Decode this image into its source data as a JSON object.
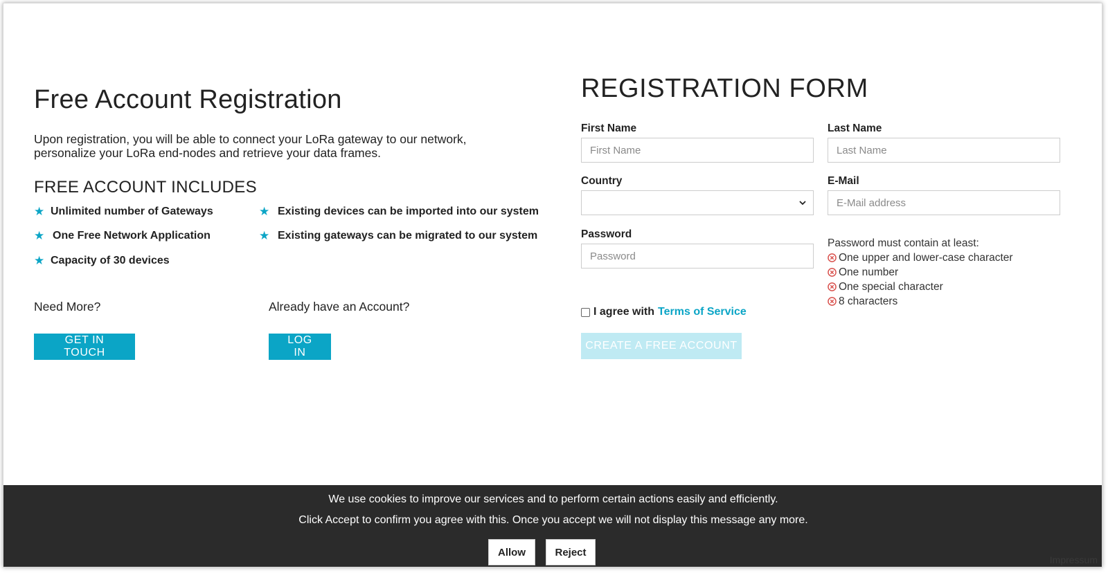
{
  "left": {
    "title": "Free Account Registration",
    "intro": "Upon registration, you will be able to connect your LoRa gateway to our network, personalize your LoRa end-nodes and retrieve your data frames.",
    "includes_title": "FREE ACCOUNT INCLUDES",
    "features": [
      "Unlimited number of Gateways",
      "One Free Network Application",
      "Capacity of 30 devices",
      "Existing devices can be imported into our system",
      "Existing gateways can be migrated to our system"
    ],
    "need_more": "Need More?",
    "get_in_touch": "GET IN TOUCH",
    "have_account": "Already have an Account?",
    "log_in": "LOG IN"
  },
  "form": {
    "title": "REGISTRATION FORM",
    "first_name_label": "First Name",
    "first_name_placeholder": "First Name",
    "last_name_label": "Last Name",
    "last_name_placeholder": "Last Name",
    "country_label": "Country",
    "country_value": "",
    "email_label": "E-Mail",
    "email_placeholder": "E-Mail address",
    "password_label": "Password",
    "password_placeholder": "Password",
    "password_rules_title": "Password must contain at least:",
    "password_rules": [
      "One upper and lower-case character",
      "One number",
      "One special character",
      "8 characters"
    ],
    "agree_text": "I agree with",
    "tos_link": "Terms of Service",
    "submit": "CREATE A FREE ACCOUNT"
  },
  "cookie": {
    "line1": "We use cookies to improve our services and to perform certain actions easily and efficiently.",
    "line2": "Click Accept to confirm you agree with this. Once you accept we will not display this message any more.",
    "allow": "Allow",
    "reject": "Reject"
  },
  "footer": {
    "impressum": "Impressum"
  },
  "colors": {
    "accent": "#0ba5c6",
    "accent_disabled": "#bfeaf3",
    "cookie_bg": "#2b2b2b",
    "error": "#d9534f"
  },
  "icons": {
    "feature": "star-icon",
    "rule": "error-x-icon",
    "select": "chevron-down-icon"
  }
}
